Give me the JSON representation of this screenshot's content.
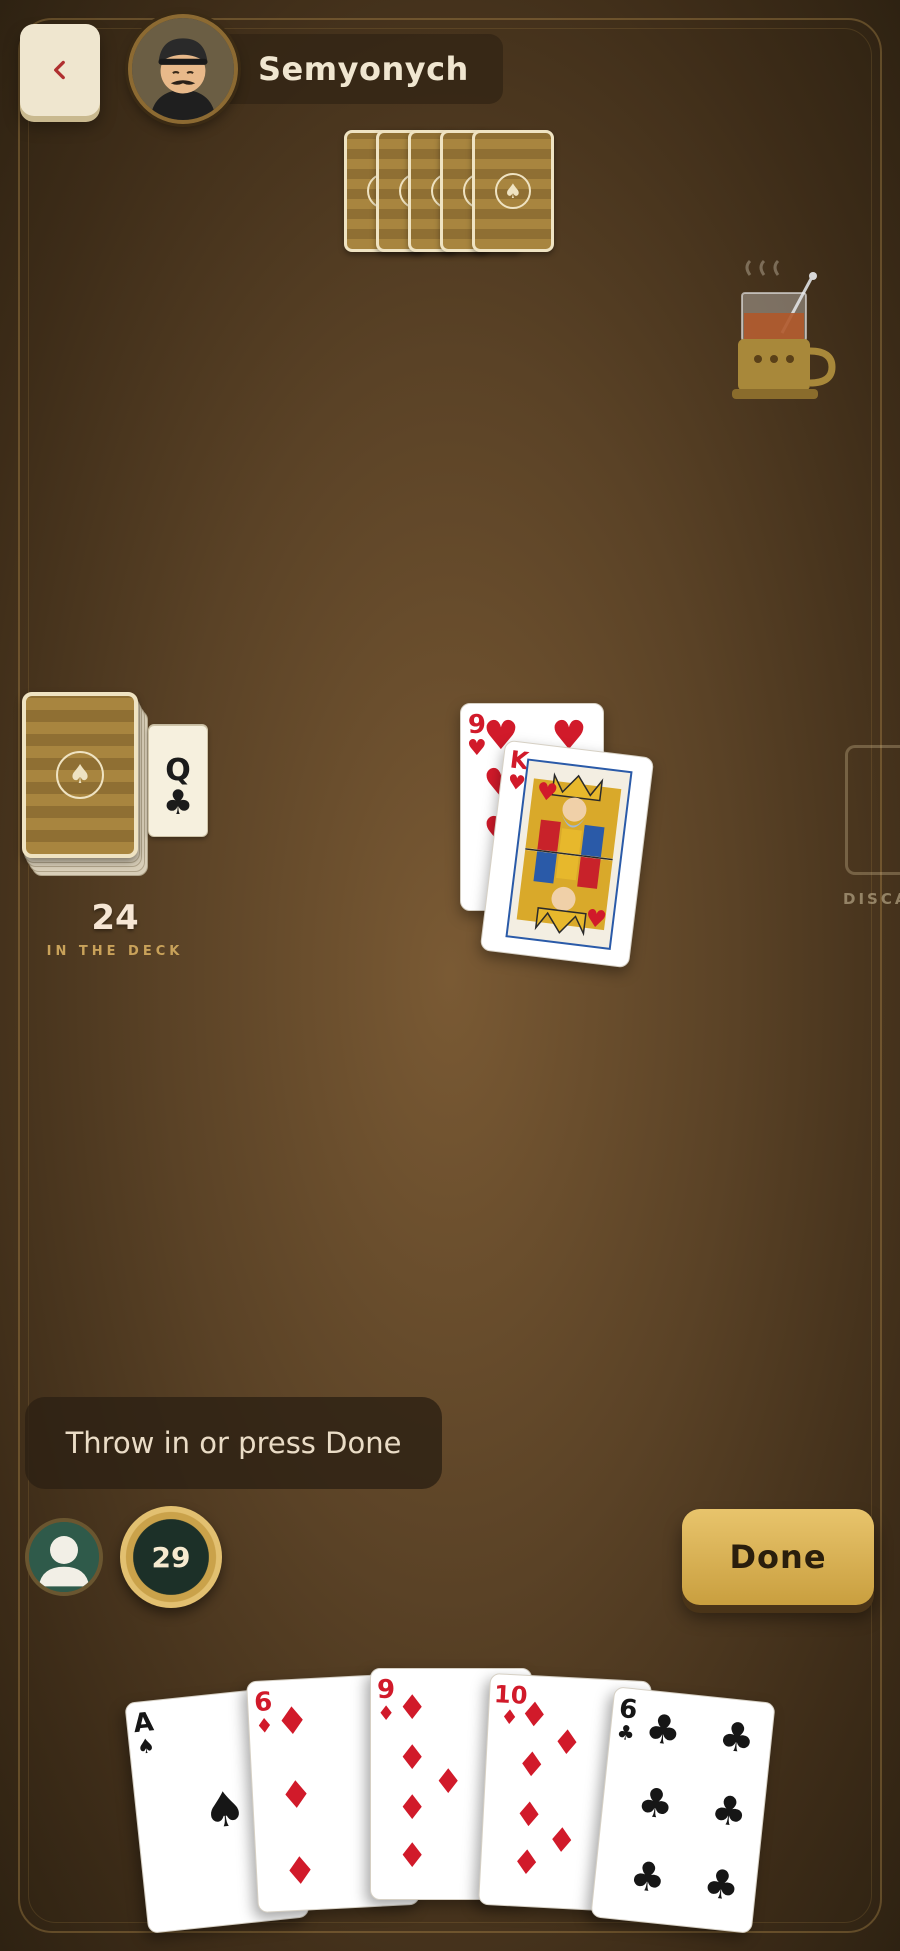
{
  "opponent": {
    "name": "Semyonych",
    "cards_in_hand": 5
  },
  "deck": {
    "count": "24",
    "label": "IN THE DECK",
    "trump": {
      "rank": "Q",
      "suit": "♣"
    }
  },
  "table": {
    "attack": {
      "rank": "9",
      "suit": "♥"
    },
    "defense": {
      "rank": "K",
      "suit": "♥"
    }
  },
  "discard": {
    "label": "DISCARD"
  },
  "message": "Throw in or press Done",
  "timer": "29",
  "done_button": "Done",
  "hand": [
    {
      "rank": "A",
      "suit": "♠"
    },
    {
      "rank": "6",
      "suit": "♦"
    },
    {
      "rank": "9",
      "suit": "♦"
    },
    {
      "rank": "10",
      "suit": "♦"
    },
    {
      "rank": "6",
      "suit": "♣"
    }
  ],
  "colors": {
    "red_suit": "#d11a2a",
    "black_suit": "#161616",
    "accent_gold": "#d9b45a",
    "felt": "#6b4e2c"
  },
  "icons": {
    "back": "chevron-left-icon",
    "tea": "tea-glass-icon",
    "deck_emblem": "spade-emblem-icon"
  }
}
